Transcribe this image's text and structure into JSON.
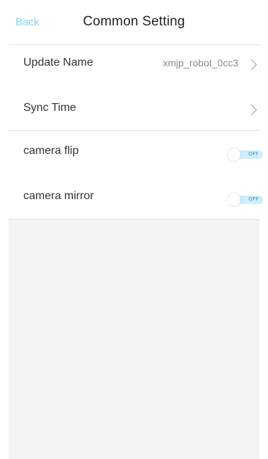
{
  "header": {
    "back_label": "Back",
    "title": "Common Setting"
  },
  "rows": [
    {
      "label": "Update Name",
      "value": "xmjp_robot_0cc3"
    },
    {
      "label": "Sync Time"
    },
    {
      "label": "camera flip",
      "toggle_text": "OFF",
      "state": "off"
    },
    {
      "label": "camera mirror",
      "toggle_text": "OFF",
      "state": "off"
    }
  ],
  "colors": {
    "accent": "#7fd6f2",
    "toggle_track": "#cfeefb",
    "background_empty": "#f3f3f3"
  }
}
